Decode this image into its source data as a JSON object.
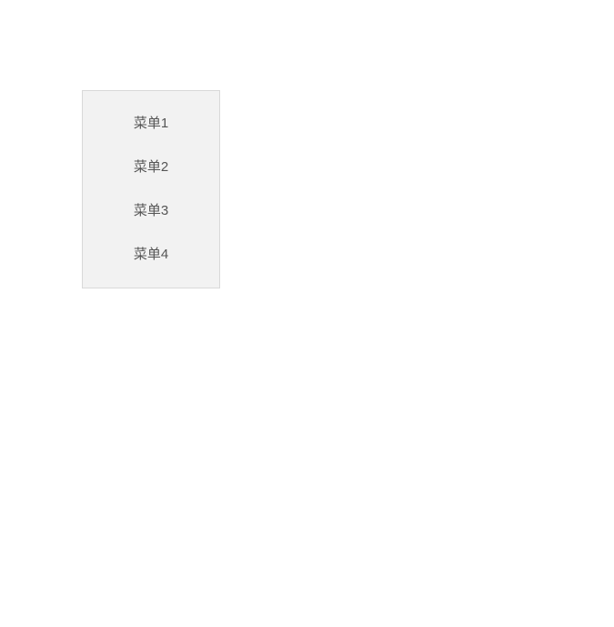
{
  "menu": {
    "items": [
      {
        "label": "菜单1"
      },
      {
        "label": "菜单2"
      },
      {
        "label": "菜单3"
      },
      {
        "label": "菜单4"
      }
    ]
  }
}
